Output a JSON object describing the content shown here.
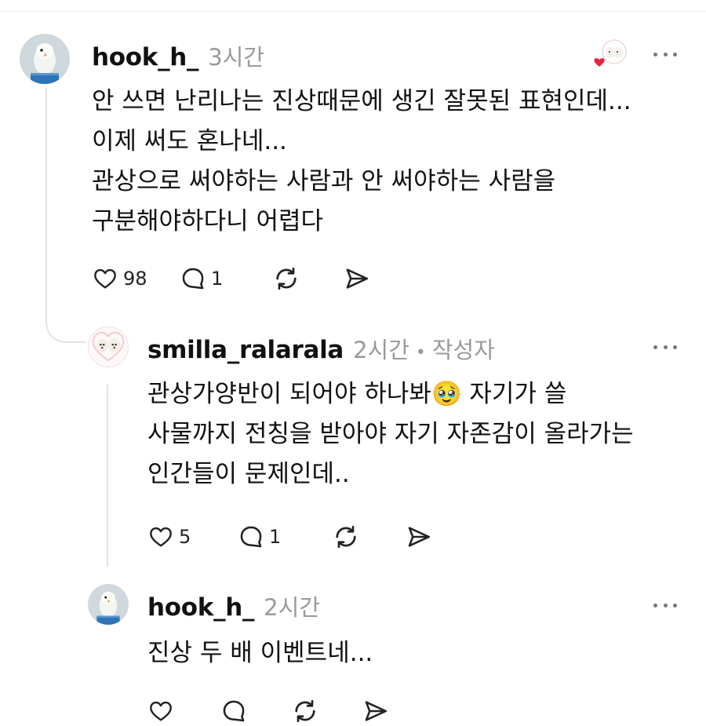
{
  "comments": [
    {
      "username": "hook_h_",
      "time": "3시간",
      "text": "안 쓰면 난리나는 진상때문에 생긴 잘못된 표현인데...\n이제 써도 혼나네...\n관상으로 써야하는 사람과 안 써야하는 사람을\n구분해야하다니 어렵다",
      "likes": "98",
      "replies": "1",
      "avatar_icon": "parrot-avatar-icon",
      "liked_by_author": true
    },
    {
      "username": "smilla_ralarala",
      "time": "2시간",
      "separator": "•",
      "author_tag": "작성자",
      "text_before_emoji": "관상가양반이 되어야 하나봐",
      "emoji": "🥹",
      "text_after_emoji": " 자기가 쓸\n사물까지 전칭을 받아야 자기 자존감이 올라가는\n인간들이 문제인데..",
      "likes": "5",
      "replies": "1",
      "avatar_icon": "dogs-avatar-icon"
    },
    {
      "username": "hook_h_",
      "time": "2시간",
      "text": "진상 두 배 이벤트네...",
      "likes": "",
      "replies": "",
      "avatar_icon": "parrot-avatar-icon"
    }
  ],
  "colors": {
    "text": "#111111",
    "muted": "#9a9a9a",
    "heart_badge": "#e8243c",
    "thread_line": "#e3e3e3"
  }
}
